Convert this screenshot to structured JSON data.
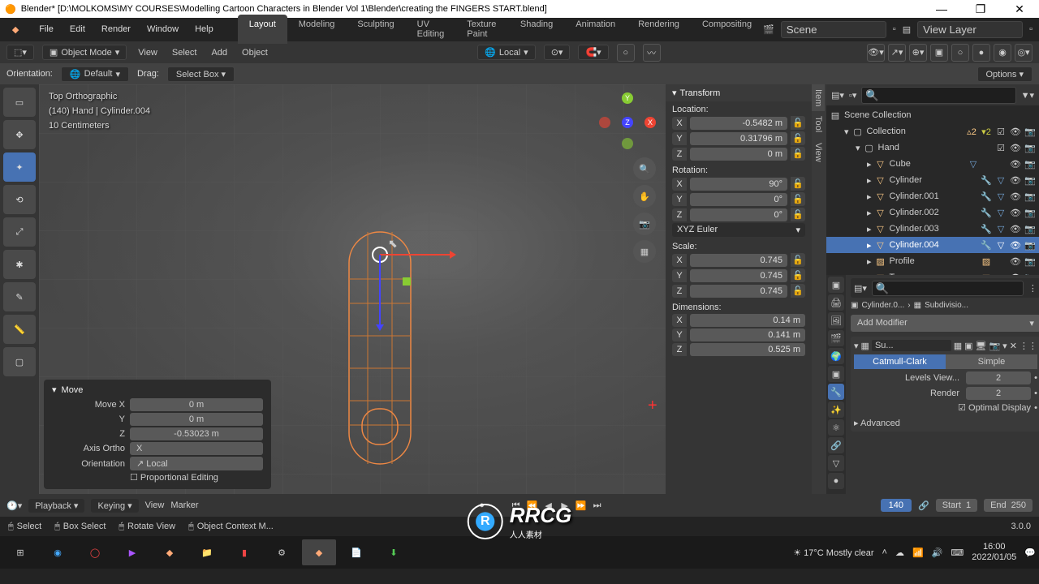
{
  "window": {
    "title": "Blender* [D:\\MOLKOMS\\MY COURSES\\Modelling  Cartoon Characters in Blender Vol 1\\Blender\\creating the FINGERS START.blend]",
    "min": "—",
    "max": "❐",
    "close": "✕"
  },
  "menu": {
    "file": "File",
    "edit": "Edit",
    "render": "Render",
    "window": "Window",
    "help": "Help"
  },
  "tabs": {
    "layout": "Layout",
    "modeling": "Modeling",
    "sculpting": "Sculpting",
    "uv": "UV Editing",
    "tex": "Texture Paint",
    "shading": "Shading",
    "anim": "Animation",
    "rendering": "Rendering",
    "comp": "Compositing"
  },
  "scene": {
    "label": "Scene",
    "layer": "View Layer"
  },
  "header3d": {
    "mode": "Object Mode",
    "view": "View",
    "select": "Select",
    "add": "Add",
    "object": "Object",
    "orient": "Local",
    "options": "Options ▾"
  },
  "orientationbar": {
    "label": "Orientation:",
    "value": "Default",
    "drag": "Drag:",
    "dragval": "Select Box ▾"
  },
  "viewinfo": {
    "l1": "Top Orthographic",
    "l2": "(140) Hand | Cylinder.004",
    "l3": "10 Centimeters"
  },
  "gizmo": {
    "x": "X",
    "y": "Y",
    "z": "Z"
  },
  "npanel": {
    "transform": "Transform",
    "location": "Location:",
    "rotation": "Rotation:",
    "scale": "Scale:",
    "dimensions": "Dimensions:",
    "loc": {
      "x": "-0.5482 m",
      "y": "0.31796 m",
      "z": "0 m"
    },
    "rot": {
      "x": "90°",
      "y": "0°",
      "z": "0°"
    },
    "rotmode": "XYZ Euler",
    "scl": {
      "x": "0.745",
      "y": "0.745",
      "z": "0.745"
    },
    "dim": {
      "x": "0.14 m",
      "y": "0.141 m",
      "z": "0.525 m"
    },
    "xyz": {
      "x": "X",
      "y": "Y",
      "z": "Z"
    },
    "tabs": {
      "item": "Item",
      "tool": "Tool",
      "view": "View"
    }
  },
  "oper": {
    "title": "Move",
    "movex": {
      "k": "Move X",
      "v": "0 m"
    },
    "movey": {
      "k": "Y",
      "v": "0 m"
    },
    "movez": {
      "k": "Z",
      "v": "-0.53023 m"
    },
    "axis": {
      "k": "Axis Ortho",
      "v": "X"
    },
    "orient": {
      "k": "Orientation",
      "v": "Local"
    },
    "prop": "Proportional Editing"
  },
  "outliner": {
    "coll": "Scene Collection",
    "collection": "Collection",
    "hand": "Hand",
    "cube": "Cube",
    "cyl": "Cylinder",
    "cyl001": "Cylinder.001",
    "cyl002": "Cylinder.002",
    "cyl003": "Cylinder.003",
    "cyl004": "Cylinder.004",
    "profile": "Profile",
    "top": "Top",
    "badge2": "2"
  },
  "props": {
    "search_ph": "",
    "crumb_obj": "Cylinder.0...",
    "crumb_mod": "Subdivisio...",
    "addmod": "Add Modifier",
    "modname": "Su...",
    "catmull": "Catmull-Clark",
    "simple": "Simple",
    "levview": "Levels View...",
    "levview_v": "2",
    "render": "Render",
    "render_v": "2",
    "optdisp": "Optimal Display",
    "advanced": "Advanced"
  },
  "timeline": {
    "playback": "Playback ▾",
    "keying": "Keying ▾",
    "view": "View",
    "marker": "Marker",
    "frame": "140",
    "start": "Start",
    "start_v": "1",
    "end": "End",
    "end_v": "250"
  },
  "status": {
    "select": "Select",
    "box": "Box Select",
    "rotate": "Rotate View",
    "context": "Object Context M...",
    "version": "3.0.0"
  },
  "taskbar": {
    "weather": "17°C  Mostly clear",
    "time": "16:00",
    "date": "2022/01/05"
  },
  "watermark": {
    "main": "RRCG",
    "sub": "人人素材"
  }
}
